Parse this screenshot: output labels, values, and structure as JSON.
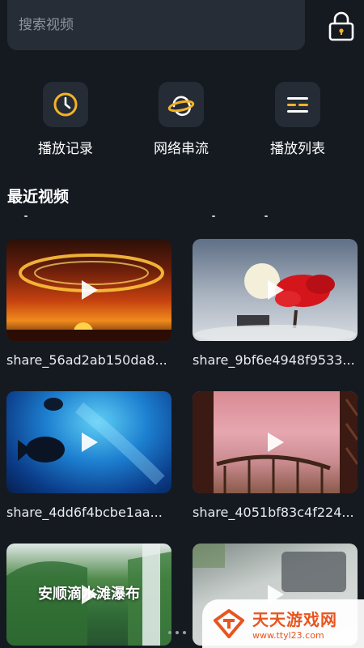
{
  "search": {
    "placeholder": "搜索视频"
  },
  "quick_actions": [
    {
      "label": "播放记录",
      "icon": "clock-icon"
    },
    {
      "label": "网络串流",
      "icon": "planet-icon"
    },
    {
      "label": "播放列表",
      "icon": "playlist-icon"
    }
  ],
  "recent": {
    "title": "最近视频",
    "videos": [
      {
        "name": "share_56ad2ab150da8...",
        "overlay": ""
      },
      {
        "name": "share_9bf6e4948f9533...",
        "overlay": ""
      },
      {
        "name": "share_4dd6f4bcbe1aa...",
        "overlay": ""
      },
      {
        "name": "share_4051bf83c4f224...",
        "overlay": ""
      },
      {
        "name": "",
        "overlay": "安顺滴水滩瀑布"
      },
      {
        "name": "",
        "overlay": ""
      }
    ]
  },
  "watermark": {
    "title": "天天游戏网",
    "url": "www.ttyl23.com"
  },
  "colors": {
    "background": "#151a21",
    "tile": "#262c35",
    "accent": "#f5b324"
  }
}
